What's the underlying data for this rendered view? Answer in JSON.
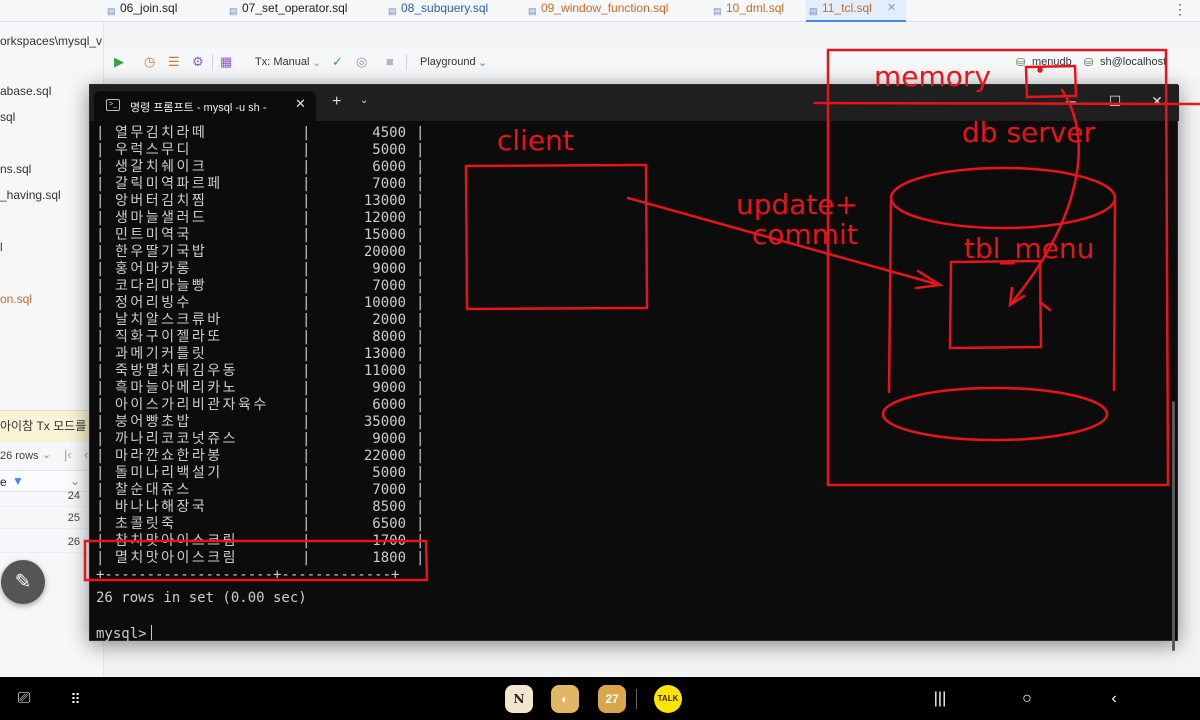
{
  "ide": {
    "tabs": [
      {
        "label": "06_join.sql"
      },
      {
        "label": "07_set_operator.sql"
      },
      {
        "label": "08_subquery.sql"
      },
      {
        "label": "09_window_function.sql"
      },
      {
        "label": "10_dml.sql"
      },
      {
        "label": "11_tcl.sql"
      }
    ],
    "path": "orkspaces\\mysql_v",
    "project_items": [
      "abase.sql",
      "sql",
      "ns.sql",
      "_having.sql",
      "l",
      "on.sql"
    ],
    "toolbar": {
      "tx_mode": "Tx: Manual",
      "playground": "Playground",
      "database": "menudb",
      "connection": "sh@localhost"
    },
    "tx_notice": "아이참 Tx 모드를 M",
    "results": {
      "rows_label": "26 rows",
      "col_header": "e",
      "row_numbers": [
        "24",
        "25",
        "26"
      ]
    }
  },
  "terminal": {
    "tab_title": "명령 프롬프트 - mysql  -u sh -",
    "rows": [
      {
        "name": "열무김치라떼",
        "price": "4500"
      },
      {
        "name": "우럭스무디",
        "price": "5000"
      },
      {
        "name": "생갈치쉐이크",
        "price": "6000"
      },
      {
        "name": "갈릭미역파르페",
        "price": "7000"
      },
      {
        "name": "앙버터김치찜",
        "price": "13000"
      },
      {
        "name": "생마늘샐러드",
        "price": "12000"
      },
      {
        "name": "민트미역국",
        "price": "15000"
      },
      {
        "name": "한우딸기국밥",
        "price": "20000"
      },
      {
        "name": "홍어마카롱",
        "price": "9000"
      },
      {
        "name": "코다리마늘빵",
        "price": "7000"
      },
      {
        "name": "정어리빙수",
        "price": "10000"
      },
      {
        "name": "날치알스크류바",
        "price": "2000"
      },
      {
        "name": "직화구이젤라또",
        "price": "8000"
      },
      {
        "name": "과메기커틀릿",
        "price": "13000"
      },
      {
        "name": "죽방멸치튀김우동",
        "price": "11000"
      },
      {
        "name": "흑마늘아메리카노",
        "price": "9000"
      },
      {
        "name": "아이스가리비관자육수",
        "price": "6000"
      },
      {
        "name": "붕어빵초밥",
        "price": "35000"
      },
      {
        "name": "까나리코코넛쥬스",
        "price": "9000"
      },
      {
        "name": "마라깐쇼한라봉",
        "price": "22000"
      },
      {
        "name": "돌미나리백설기",
        "price": "5000"
      },
      {
        "name": "찰순대쥬스",
        "price": "7000"
      },
      {
        "name": "바나나해장국",
        "price": "8500"
      },
      {
        "name": "초콜릿죽",
        "price": "6500"
      },
      {
        "name": "참치맛아이스크림",
        "price": "1700"
      },
      {
        "name": "멸치맛아이스크림",
        "price": "1800"
      }
    ],
    "border_line": "+--------------------+-------------+",
    "status": "26 rows in set (0.00 sec)",
    "prompt": "mysql>"
  },
  "annotations": {
    "client": "client",
    "memory": "memory",
    "db_server": "db server",
    "update": "update+",
    "commit": "commit",
    "tbl_menu": "tbl_menu",
    "color": "#e8141c"
  },
  "navbar": {
    "calendar_day": "27",
    "talk_label": "TALK"
  }
}
